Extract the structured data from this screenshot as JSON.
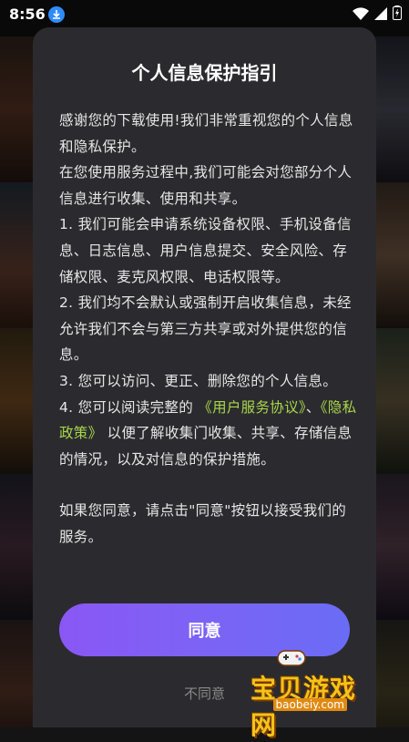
{
  "status_bar": {
    "time": "8:56"
  },
  "dialog": {
    "title": "个人信息保护指引",
    "paragraphs": {
      "p1": "感谢您的下载使用!我们非常重视您的个人信息和隐私保护。",
      "p2": "在您使用服务过程中,我们可能会对您部分个人信息进行收集、使用和共享。",
      "p3": "1. 我们可能会申请系统设备权限、手机设备信息、日志信息、用户信息提交、安全风险、存储权限、麦克风权限、电话权限等。",
      "p4": "2. 我们均不会默认或强制开启收集信息，未经允许我们不会与第三方共享或对外提供您的信息。",
      "p5": "3. 您可以访问、更正、删除您的个人信息。",
      "p6_prefix": "4. 您可以阅读完整的",
      "link_user_agreement": "《用户服务协议》",
      "p6_sep": "、",
      "link_privacy_policy": "《隐私政策》",
      "p6_suffix": "以便了解收集门收集、共享、存储信息的情况，以及对信息的保护措施。",
      "p7": "如果您同意，请点击\"同意\"按钮以接受我们的服务。"
    },
    "agree_label": "同意",
    "disagree_label": "不同意"
  },
  "watermark": {
    "name": "宝贝游戏网",
    "url": "baobeiy.com"
  },
  "colors": {
    "dialog_bg": "#2b2b2f",
    "link": "#a8d64a",
    "agree_gradient_start": "#8a57f5",
    "agree_gradient_end": "#6a6cf6"
  }
}
